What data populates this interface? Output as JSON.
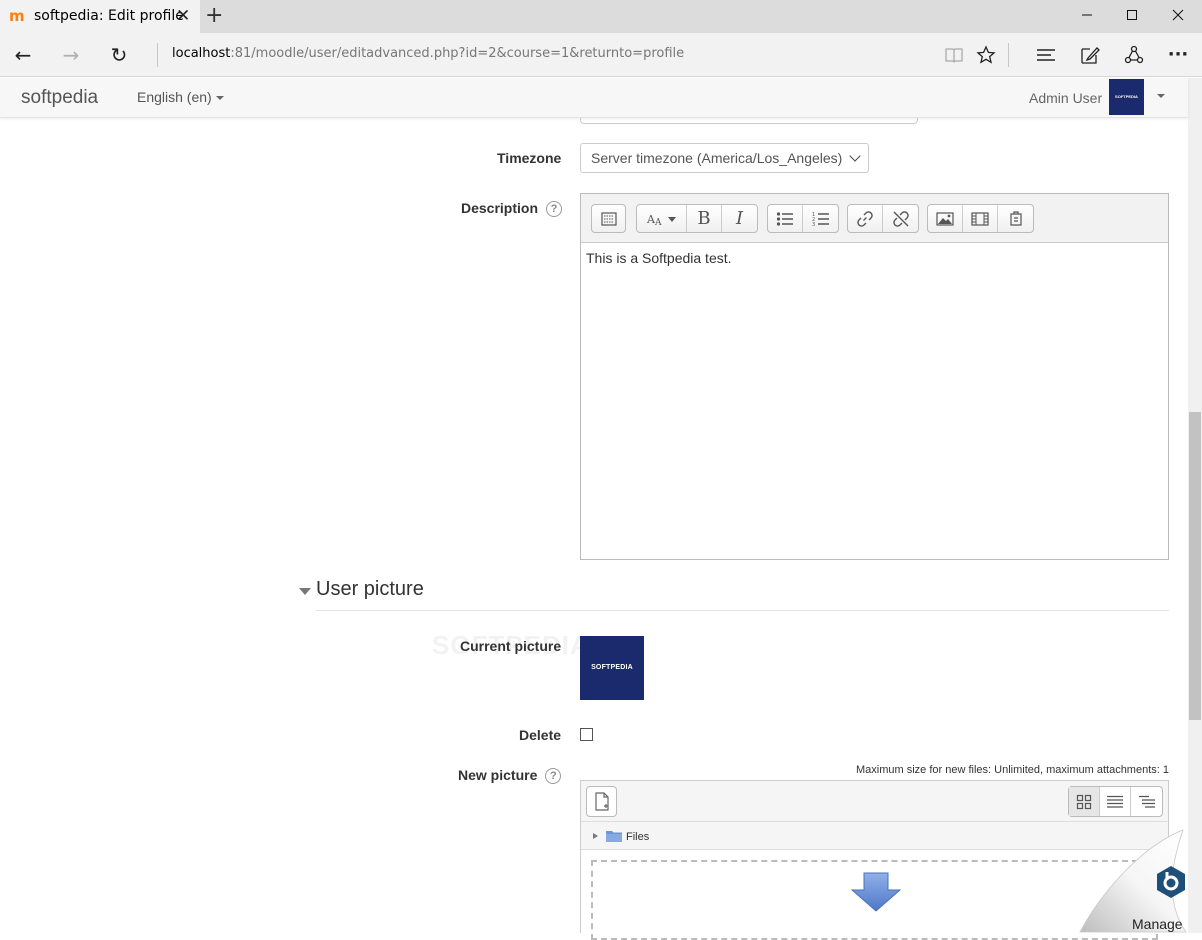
{
  "browser": {
    "tab_title": "softpedia: Edit profile",
    "favicon_glyph": "m",
    "tab_close": "✕",
    "new_tab": "+",
    "win_minimize": "—",
    "win_maximize": "☐",
    "win_close": "✕",
    "nav_back": "←",
    "nav_forward": "→",
    "nav_refresh": "↻",
    "url_host": "localhost",
    "url_rest": ":81/moodle/user/editadvanced.php?id=2&course=1&returnto=profile",
    "tools": [
      "reading-view-icon",
      "favorite-star-icon",
      "hub-icon",
      "web-note-icon",
      "share-icon",
      "more-icon"
    ],
    "more_glyph": "···"
  },
  "navbar": {
    "brand": "softpedia",
    "language": "English (en)",
    "user_name": "Admin User",
    "avatar_text": "SOFTPEDIA"
  },
  "form": {
    "timezone_label": "Timezone",
    "timezone_value": "Server timezone (America/Los_Angeles)",
    "description_label": "Description",
    "help_glyph": "?",
    "editor_text": "This is a Softpedia test.",
    "editor_tools": [
      [
        "toggle-toolbar-icon"
      ],
      [
        "font-style-icon",
        "bold-icon",
        "italic-icon"
      ],
      [
        "unordered-list-icon",
        "ordered-list-icon"
      ],
      [
        "link-icon",
        "unlink-icon"
      ],
      [
        "image-icon",
        "media-icon",
        "manage-files-icon"
      ]
    ],
    "bold_glyph": "B",
    "italic_glyph": "I",
    "section_title": "User picture",
    "current_picture_label": "Current picture",
    "current_picture_text": "SOFTPEDIA",
    "watermark_text": "SOFTPEDIA",
    "delete_label": "Delete",
    "delete_checked": false,
    "new_picture_label": "New picture",
    "max_size_text": "Maximum size for new files: Unlimited, maximum attachments: 1",
    "files_label": "Files",
    "file_views": [
      "icons-view-icon",
      "list-view-icon",
      "tree-view-icon"
    ],
    "active_file_view": 0
  },
  "manage": {
    "label": "Manage"
  },
  "colors": {
    "moodle_orange": "#f98012",
    "softpedia_blue": "#1a2a6c",
    "drop_arrow": "#6f95d6",
    "manage_hex": "#1e4f78"
  }
}
